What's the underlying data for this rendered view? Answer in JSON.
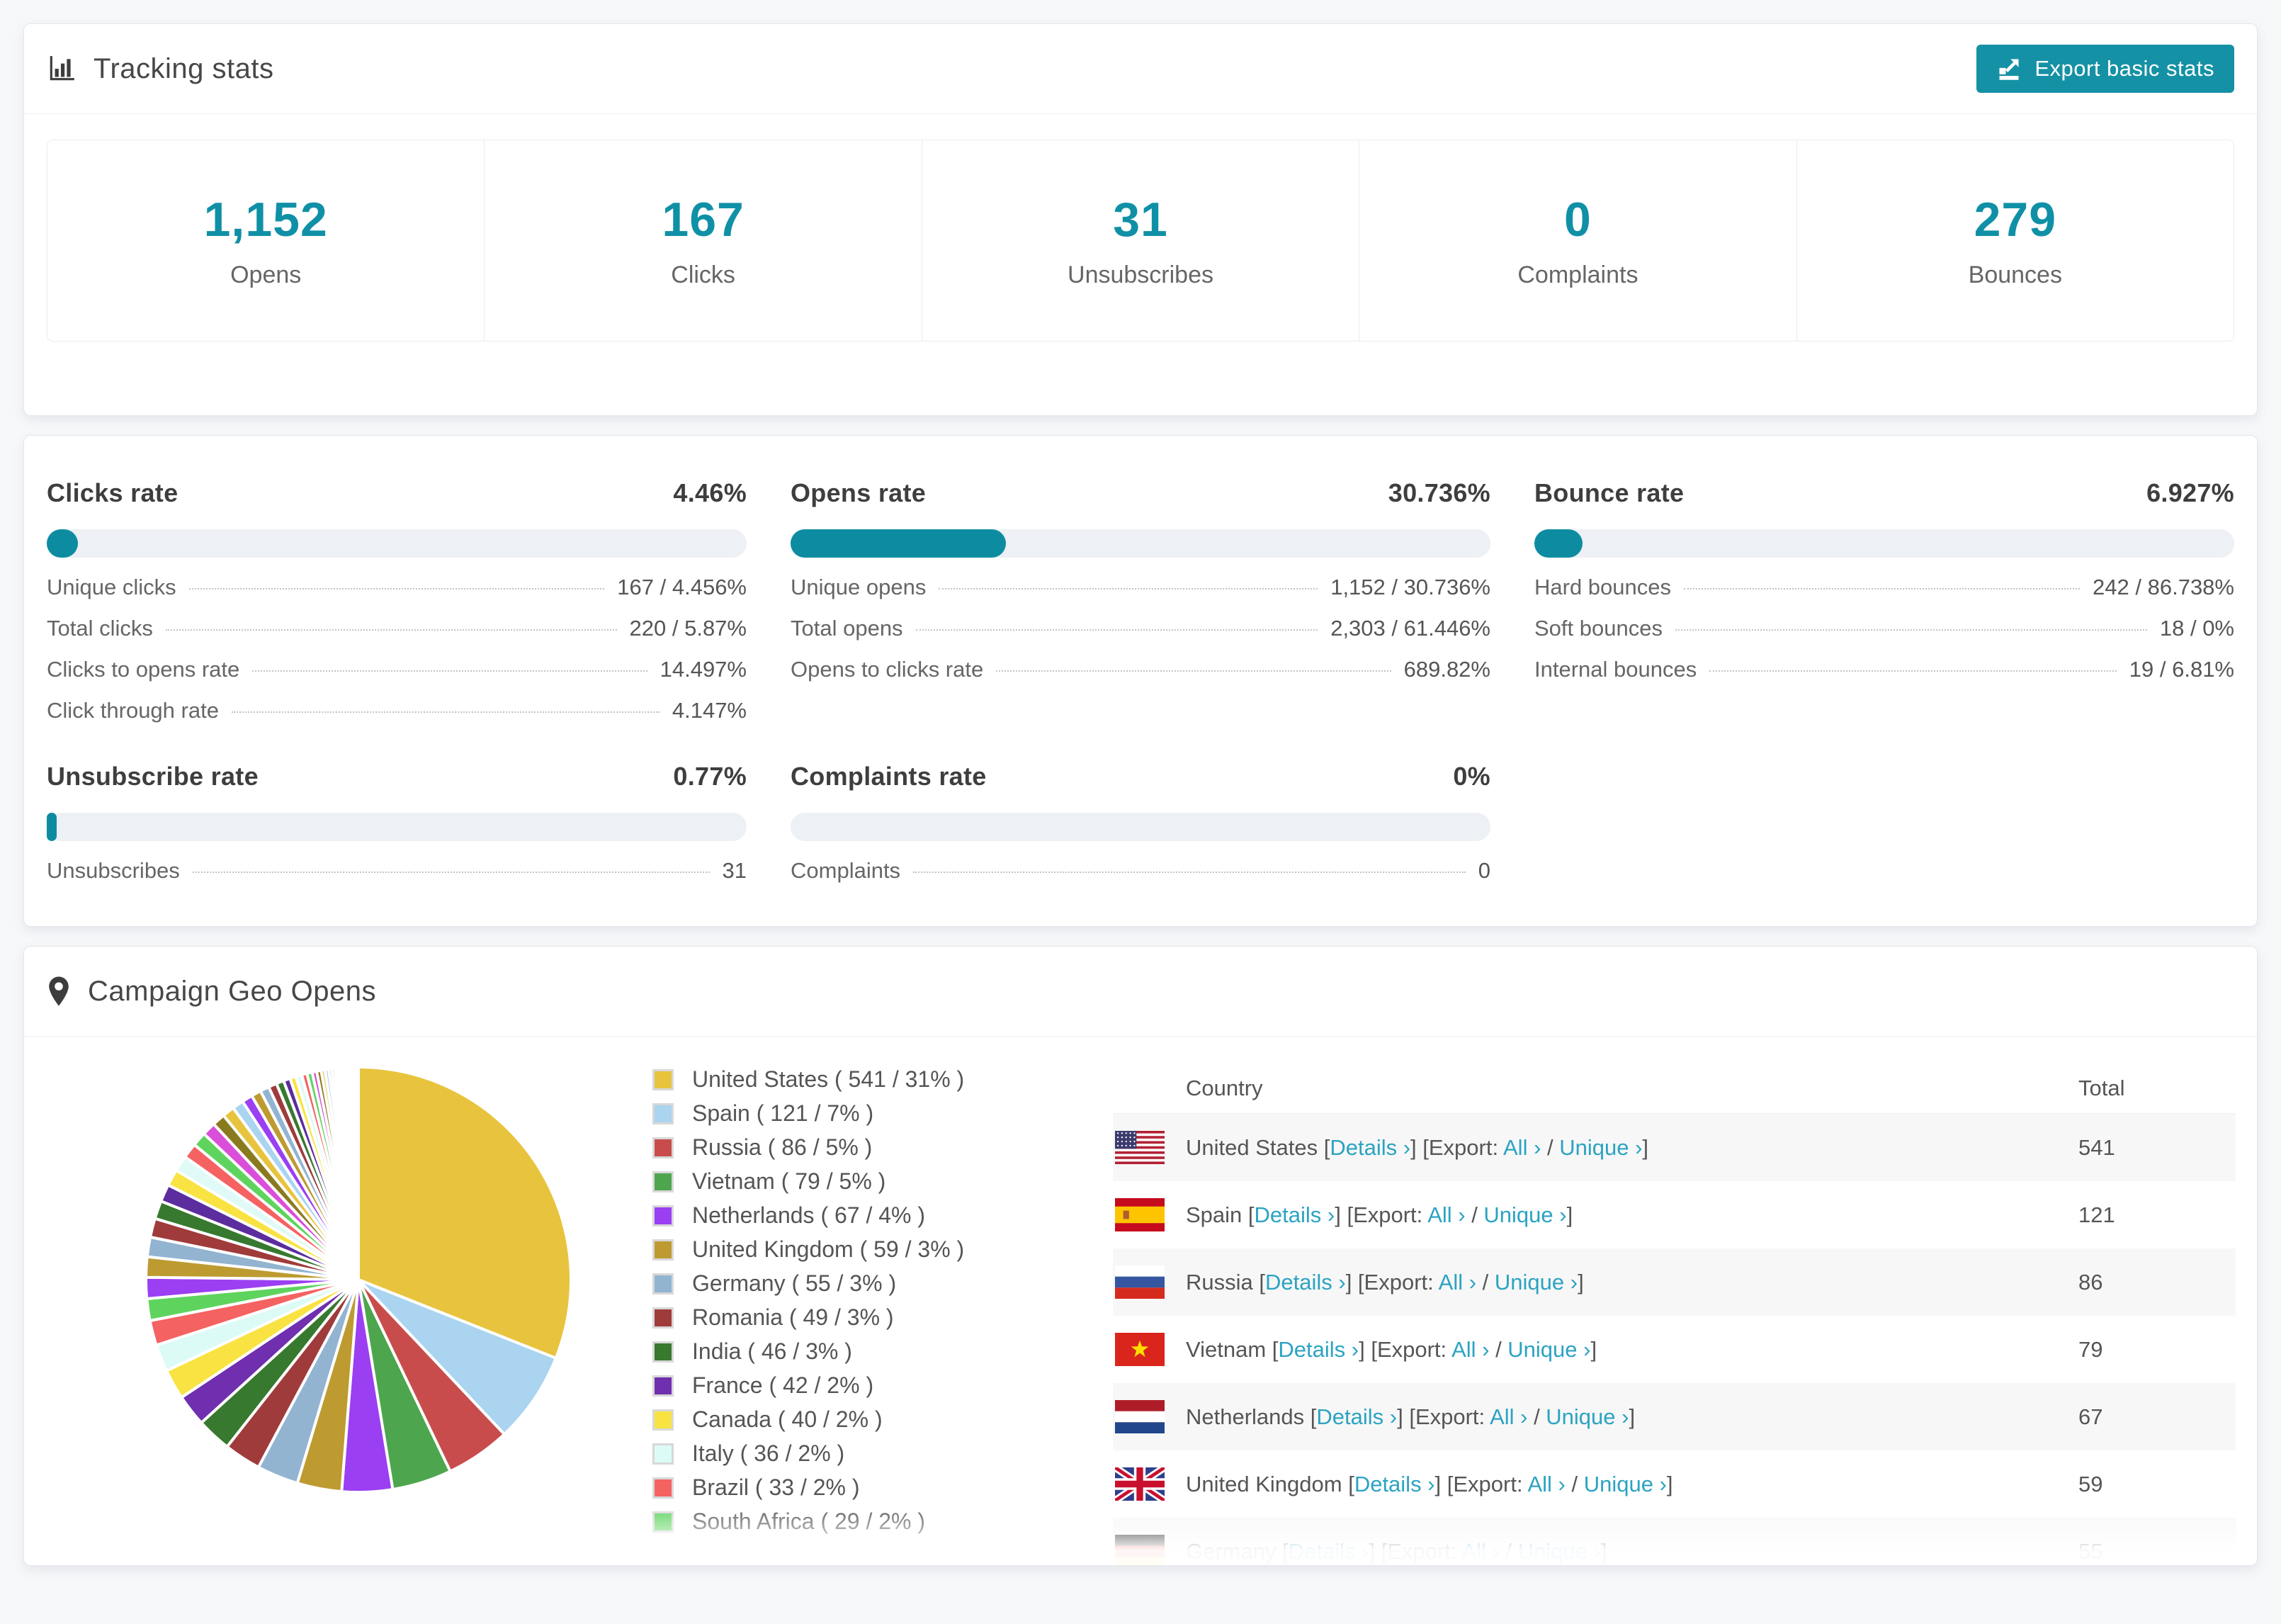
{
  "accent": "#1090a6",
  "header": {
    "title": "Tracking stats",
    "export_label": "Export basic stats"
  },
  "stats": [
    {
      "value": "1,152",
      "label": "Opens"
    },
    {
      "value": "167",
      "label": "Clicks"
    },
    {
      "value": "31",
      "label": "Unsubscribes"
    },
    {
      "value": "0",
      "label": "Complaints"
    },
    {
      "value": "279",
      "label": "Bounces"
    }
  ],
  "rates": [
    {
      "title": "Clicks rate",
      "value": "4.46%",
      "percent": 4.46,
      "rows": [
        {
          "label": "Unique clicks",
          "value": "167 / 4.456%"
        },
        {
          "label": "Total clicks",
          "value": "220 / 5.87%"
        },
        {
          "label": "Clicks to opens rate",
          "value": "14.497%"
        },
        {
          "label": "Click through rate",
          "value": "4.147%"
        }
      ]
    },
    {
      "title": "Opens rate",
      "value": "30.736%",
      "percent": 30.736,
      "rows": [
        {
          "label": "Unique opens",
          "value": "1,152 / 30.736%"
        },
        {
          "label": "Total opens",
          "value": "2,303 / 61.446%"
        },
        {
          "label": "Opens to clicks rate",
          "value": "689.82%"
        }
      ]
    },
    {
      "title": "Bounce rate",
      "value": "6.927%",
      "percent": 6.927,
      "rows": [
        {
          "label": "Hard bounces",
          "value": "242 / 86.738%"
        },
        {
          "label": "Soft bounces",
          "value": "18 / 0%"
        },
        {
          "label": "Internal bounces",
          "value": "19 / 6.81%"
        }
      ]
    },
    {
      "title": "Unsubscribe rate",
      "value": "0.77%",
      "percent": 0.77,
      "rows": [
        {
          "label": "Unsubscribes",
          "value": "31"
        }
      ]
    },
    {
      "title": "Complaints rate",
      "value": "0%",
      "percent": 0,
      "rows": [
        {
          "label": "Complaints",
          "value": "0"
        }
      ]
    }
  ],
  "geo": {
    "title": "Campaign Geo Opens",
    "table": {
      "country_header": "Country",
      "total_header": "Total",
      "links": {
        "details": "Details ›",
        "export_prefix": "Export:",
        "all": "All ›",
        "unique": "Unique ›"
      },
      "rows": [
        {
          "country": "United States",
          "flag": "us",
          "total": "541"
        },
        {
          "country": "Spain",
          "flag": "es",
          "total": "121"
        },
        {
          "country": "Russia",
          "flag": "ru",
          "total": "86"
        },
        {
          "country": "Vietnam",
          "flag": "vn",
          "total": "79"
        },
        {
          "country": "Netherlands",
          "flag": "nl",
          "total": "67"
        },
        {
          "country": "United Kingdom",
          "flag": "gb",
          "total": "59"
        },
        {
          "country": "Germany",
          "flag": "de",
          "total": "55"
        }
      ]
    }
  },
  "chart_data": {
    "type": "pie",
    "title": "Campaign Geo Opens",
    "legend_position": "right",
    "labels": [
      "United States",
      "Spain",
      "Russia",
      "Vietnam",
      "Netherlands",
      "United Kingdom",
      "Germany",
      "Romania",
      "India",
      "France",
      "Canada",
      "Italy",
      "Brazil",
      "South Africa"
    ],
    "values": [
      541,
      121,
      86,
      79,
      67,
      59,
      55,
      49,
      46,
      42,
      40,
      36,
      33,
      29
    ],
    "percents": [
      31,
      7,
      5,
      5,
      4,
      3,
      3,
      3,
      3,
      2,
      2,
      2,
      2,
      2
    ],
    "legend_entries": [
      "United States ( 541 / 31% )",
      "Spain ( 121 / 7% )",
      "Russia ( 86 / 5% )",
      "Vietnam ( 79 / 5% )",
      "Netherlands ( 67 / 4% )",
      "United Kingdom ( 59 / 3% )",
      "Germany ( 55 / 3% )",
      "Romania ( 49 / 3% )",
      "India ( 46 / 3% )",
      "France ( 42 / 2% )",
      "Canada ( 40 / 2% )",
      "Italy ( 36 / 2% )",
      "Brazil ( 33 / 2% )",
      "South Africa ( 29 / 2% )"
    ],
    "colors": [
      "#e8c33d",
      "#aad4f0",
      "#c94c4c",
      "#4da64d",
      "#9a3ff2",
      "#bd9b30",
      "#92b4d1",
      "#a03b3b",
      "#37792f",
      "#6f2fae",
      "#f9e342",
      "#dcfbf6",
      "#f56262",
      "#5ed45e"
    ],
    "others_tail": [
      28,
      27,
      26,
      25,
      24,
      23,
      22,
      21,
      20,
      19,
      18,
      17,
      16,
      15,
      14,
      13,
      12,
      11,
      10,
      9,
      8,
      8,
      7,
      7,
      6,
      6,
      5,
      5,
      4,
      4,
      3,
      3,
      3,
      2,
      2,
      2,
      2,
      2,
      1,
      1,
      1,
      1,
      1,
      1,
      1,
      1,
      1,
      1,
      1,
      1
    ],
    "tail_palette": [
      "#9a3ff2",
      "#bd9b30",
      "#92b4d1",
      "#a03b3b",
      "#37792f",
      "#5b2d9e",
      "#f9e342",
      "#e0fbf7",
      "#f56262",
      "#5ed45e",
      "#d94fd9",
      "#8a7a1e",
      "#e8c33d",
      "#aad4f0"
    ]
  }
}
